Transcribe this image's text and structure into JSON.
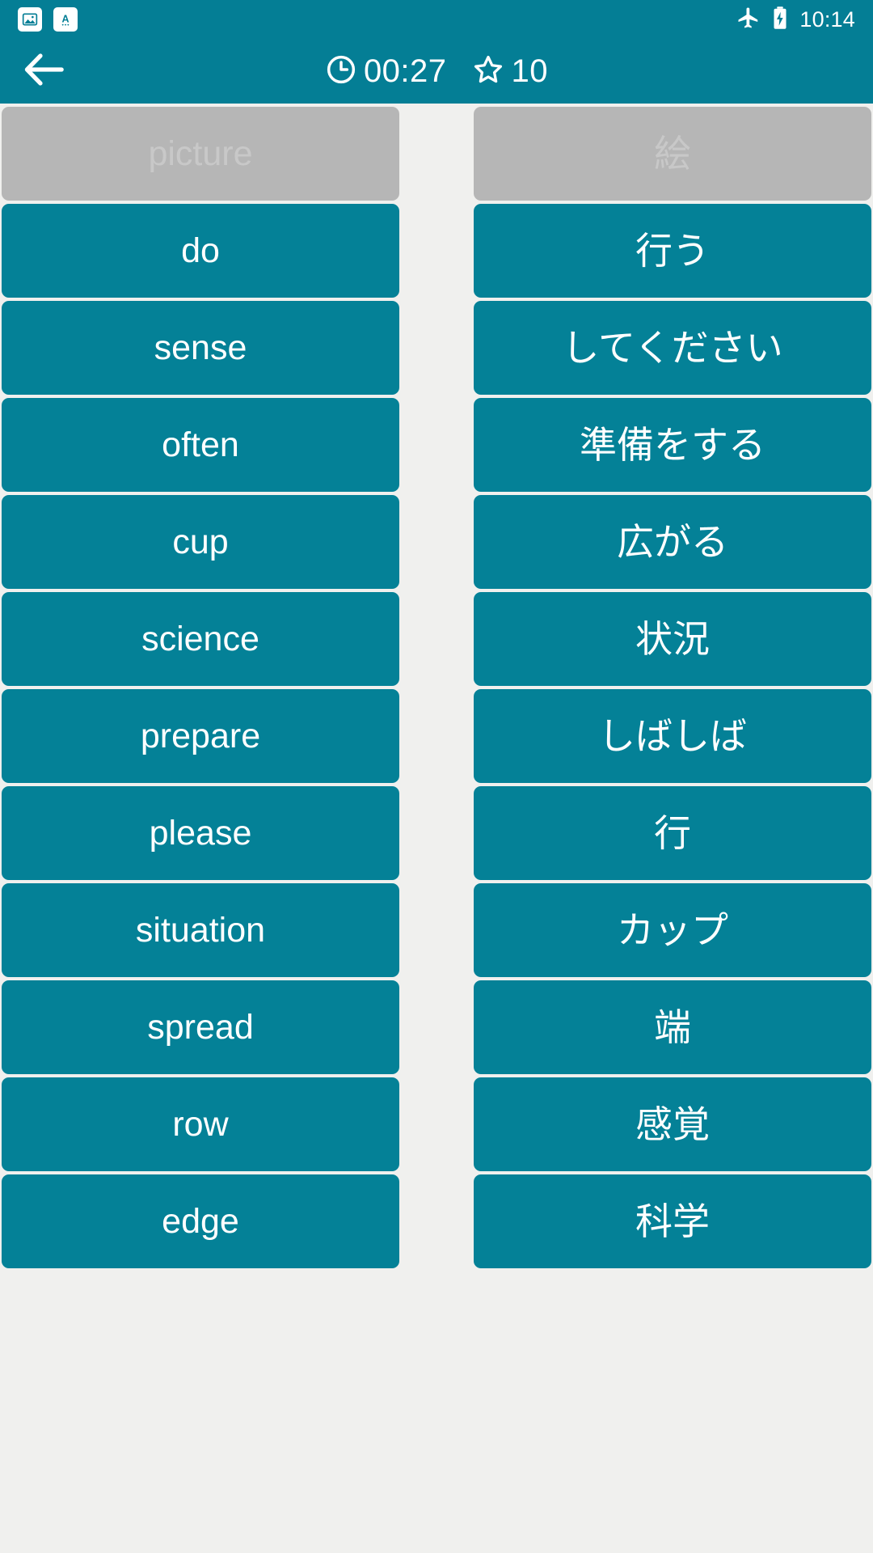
{
  "theme": {
    "header_color": "#047E95",
    "tile_color": "#048197",
    "tile_matched_color": "#B6B6B6",
    "tile_matched_text_color": "#C8C8C8",
    "page_background": "#F0F0EE",
    "text_color": "#FFFFFF"
  },
  "status_bar": {
    "notification_icons": [
      {
        "name": "image-notification-icon",
        "glyph": "image"
      },
      {
        "name": "translate-notification-icon",
        "glyph": "translate-a"
      }
    ],
    "airplane_icon": "airplane-mode-icon",
    "battery_icon": "battery-charging-icon",
    "time": "10:14"
  },
  "app_bar": {
    "back_icon": "back-arrow-icon",
    "timer": {
      "icon": "clock-icon",
      "value": "00:27"
    },
    "score": {
      "icon": "star-icon",
      "value": "10"
    }
  },
  "board": {
    "left_column": [
      {
        "label": "picture",
        "state": "matched"
      },
      {
        "label": "do",
        "state": "active"
      },
      {
        "label": "sense",
        "state": "active"
      },
      {
        "label": "often",
        "state": "active"
      },
      {
        "label": "cup",
        "state": "active"
      },
      {
        "label": "science",
        "state": "active"
      },
      {
        "label": "prepare",
        "state": "active"
      },
      {
        "label": "please",
        "state": "active"
      },
      {
        "label": "situation",
        "state": "active"
      },
      {
        "label": "spread",
        "state": "active"
      },
      {
        "label": "row",
        "state": "active"
      },
      {
        "label": "edge",
        "state": "active"
      }
    ],
    "right_column": [
      {
        "label": "絵",
        "state": "matched"
      },
      {
        "label": "行う",
        "state": "active"
      },
      {
        "label": "してください",
        "state": "active"
      },
      {
        "label": "準備をする",
        "state": "active"
      },
      {
        "label": "広がる",
        "state": "active"
      },
      {
        "label": "状況",
        "state": "active"
      },
      {
        "label": "しばしば",
        "state": "active"
      },
      {
        "label": "行",
        "state": "active"
      },
      {
        "label": "カップ",
        "state": "active"
      },
      {
        "label": "端",
        "state": "active"
      },
      {
        "label": "感覚",
        "state": "active"
      },
      {
        "label": "科学",
        "state": "active"
      }
    ]
  }
}
